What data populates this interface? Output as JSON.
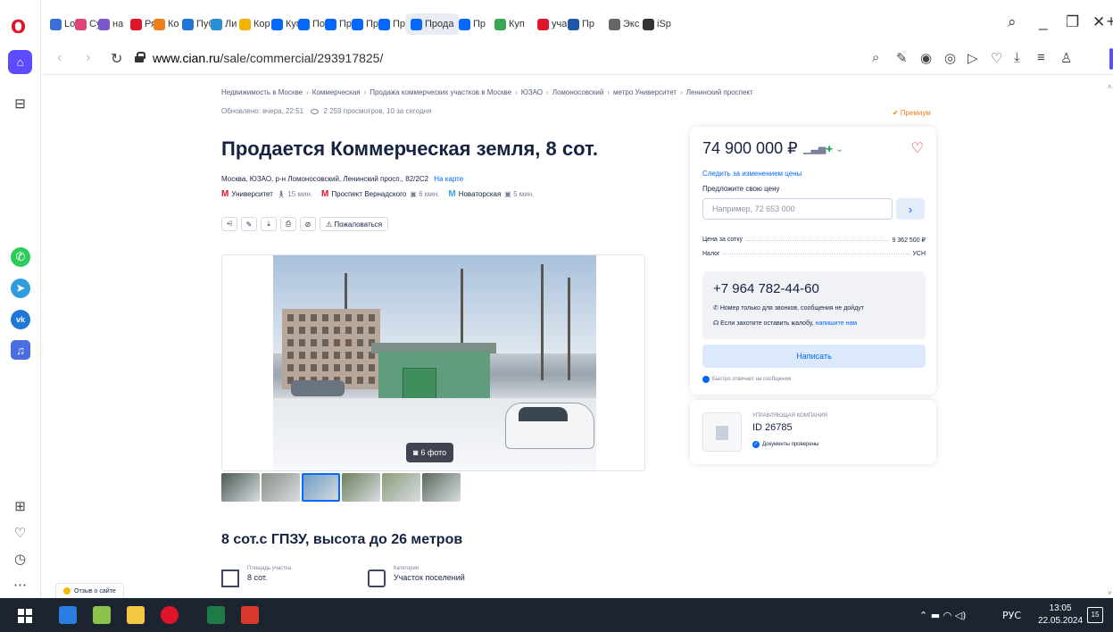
{
  "browser": {
    "tabs": [
      {
        "label": "Log",
        "color": "#3a6fd8"
      },
      {
        "label": "Cy",
        "color": "#e0457b"
      },
      {
        "label": "на",
        "color": "#7b57c9"
      },
      {
        "label": "Ряз",
        "color": "#e0152b"
      },
      {
        "label": "Ко",
        "color": "#ef7f1a"
      },
      {
        "label": "Пуб",
        "color": "#1f77d8"
      },
      {
        "label": "Ли",
        "color": "#2b8fd6"
      },
      {
        "label": "Кор",
        "color": "#f0b400"
      },
      {
        "label": "Куп",
        "color": "#0468ff"
      },
      {
        "label": "По",
        "color": "#0468ff"
      },
      {
        "label": "Пр",
        "color": "#0468ff"
      },
      {
        "label": "Пр",
        "color": "#0468ff"
      },
      {
        "label": "Пр",
        "color": "#0468ff"
      },
      {
        "label": "Прода",
        "color": "#0468ff"
      },
      {
        "label": "Пр",
        "color": "#0468ff"
      },
      {
        "label": "Куп",
        "color": "#3aa552"
      },
      {
        "label": "уча",
        "color": "#e0152b"
      },
      {
        "label": "Пр",
        "color": "#1f57a8"
      },
      {
        "label": "Экс",
        "color": "#666666"
      },
      {
        "label": "iSp",
        "color": "#333333"
      }
    ],
    "url_host": "www.cian.ru",
    "url_path": "/sale/commercial/293917825/"
  },
  "page": {
    "breadcrumb": [
      "Недвижимость в Москве",
      "Коммерческая",
      "Продажа коммерческих участков в Москве",
      "ЮЗАО",
      "Ломоносовский",
      "метро Университет",
      "Ленинский проспект"
    ],
    "updated": "Обновлено: вчера, 22:51",
    "views": "2 259 просмотров, 10 за сегодня",
    "premium": "Премиум",
    "title": "Продается Коммерческая земля, 8 сот.",
    "address": "Москва, ЮЗАО, р-н Ломоносовский, Ленинский просп., 82/2С2",
    "map_link": "На карте",
    "metro": [
      {
        "station": "Университет",
        "time": "15 мин.",
        "mode": "walk",
        "color": "#e0152b"
      },
      {
        "station": "Проспект Вернадского",
        "time": "6 мин.",
        "mode": "bus",
        "color": "#e0152b"
      },
      {
        "station": "Новаторская",
        "time": "5 мин.",
        "mode": "bus",
        "color": "#3aa6e8"
      }
    ],
    "complain_label": "Пожаловаться",
    "photo_count": "6 фото",
    "thumbnails": [
      "#4a5a52",
      "#8a8f86",
      "#6a9ac0",
      "#6f7f5c",
      "#8c9b78",
      "#5a6a5a"
    ],
    "subtitle": "8 сот.с ГПЗУ, высота до 26 метров",
    "features": [
      {
        "label": "Площадь участка",
        "value": "8 сот."
      },
      {
        "label": "Категория",
        "value": "Участок поселений"
      }
    ],
    "feedback": "Отзыв о сайте"
  },
  "card": {
    "price": "74 900 000 ₽",
    "follow_price": "Следить за изменением цены",
    "offer_label": "Предложите свою цену",
    "offer_placeholder": "Например, 72 653 000",
    "price_per_sotka_label": "Цена за сотку",
    "price_per_sotka": "9 362 500 ₽",
    "tax_label": "Налог",
    "tax": "УСН",
    "phone": "+7 964 782-44-60",
    "phone_note": "Номер только для звонков, сообщения не дойдут",
    "complain_note": "Если захотите оставить жалобу,",
    "complain_link": "напишите нам",
    "write_button": "Написать",
    "fast_reply": "Быстро отвечает на сообщения"
  },
  "agency": {
    "type": "Управляющая компания",
    "id": "ID 26785",
    "verified": "Документы проверены"
  },
  "taskbar": {
    "lang": "РУС",
    "time": "13:05",
    "date": "22.05.2024",
    "notifications": "15"
  }
}
